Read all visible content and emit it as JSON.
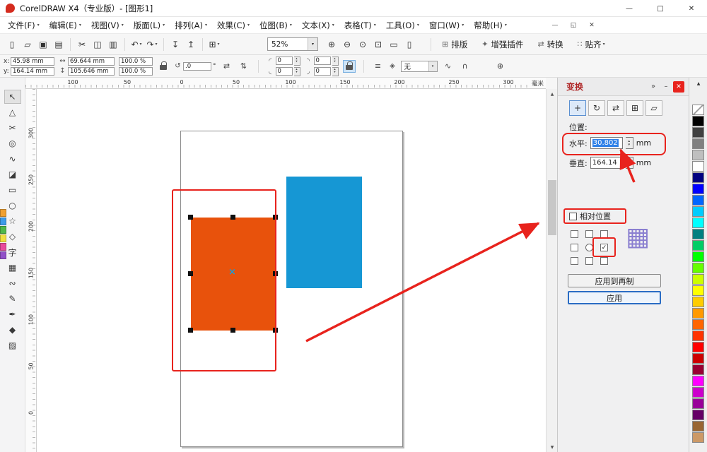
{
  "window": {
    "title": "CorelDRAW X4（专业版）- [图形1]",
    "controls": {
      "minimize": "—",
      "maximize": "□",
      "close": "✕"
    }
  },
  "menubar": {
    "items": [
      "文件(F)",
      "编辑(E)",
      "视图(V)",
      "版面(L)",
      "排列(A)",
      "效果(C)",
      "位图(B)",
      "文本(X)",
      "表格(T)",
      "工具(O)",
      "窗口(W)",
      "帮助(H)"
    ],
    "caret": "▾",
    "doc_controls": {
      "minimize": "—",
      "restore": "◱",
      "close": "✕"
    }
  },
  "glyphs": {
    "caret_down": "▾",
    "scroll_up": "▲",
    "scroll_down": "▼"
  },
  "toolbar": {
    "main_icons": [
      {
        "name": "new-document-icon",
        "glyph": "▯"
      },
      {
        "name": "open-icon",
        "glyph": "▱"
      },
      {
        "name": "save-icon",
        "glyph": "▣"
      },
      {
        "name": "print-icon",
        "glyph": "▤"
      },
      {
        "sep": true
      },
      {
        "name": "cut-icon",
        "glyph": "✂"
      },
      {
        "name": "copy-icon",
        "glyph": "◫"
      },
      {
        "name": "paste-icon",
        "glyph": "▥"
      },
      {
        "sep": true
      },
      {
        "name": "undo-icon",
        "glyph": "↶",
        "caret": true
      },
      {
        "name": "redo-icon",
        "glyph": "↷",
        "caret": true
      },
      {
        "sep": true
      },
      {
        "name": "import-icon",
        "glyph": "↧"
      },
      {
        "name": "export-icon",
        "glyph": "↥"
      },
      {
        "sep": true
      },
      {
        "name": "app-launcher-icon",
        "glyph": "⊞",
        "caret": true
      }
    ],
    "zoom_level": "52%",
    "zoom_icons": [
      {
        "name": "zoom-in-icon",
        "glyph": "⊕"
      },
      {
        "name": "zoom-out-icon",
        "glyph": "⊖"
      },
      {
        "name": "zoom-selected-icon",
        "glyph": "⊙"
      },
      {
        "name": "zoom-all-objects-icon",
        "glyph": "⊡"
      },
      {
        "name": "zoom-page-icon",
        "glyph": "▭"
      },
      {
        "name": "zoom-width-icon",
        "glyph": "▯"
      }
    ],
    "labeled_buttons": [
      {
        "name": "layout-button",
        "icon": "⊞",
        "label": "排版"
      },
      {
        "name": "plugins-button",
        "icon": "✦",
        "label": "增强插件"
      },
      {
        "name": "convert-button",
        "icon": "⇄",
        "label": "转换"
      },
      {
        "name": "snap-button",
        "icon": "∷",
        "label": "贴齐",
        "caret": true
      }
    ]
  },
  "property_bar": {
    "x_label": "x:",
    "x_value": "45.98 mm",
    "y_label": "y:",
    "y_value": "164.14 mm",
    "width_value": "69.644 mm",
    "height_value": "105.646 mm",
    "scale_h": "100.0 %",
    "scale_v": "100.0 %",
    "rotation_value": ".0",
    "degree": "°",
    "corner_tl": "0",
    "corner_bl": "0",
    "corner_tr": "0",
    "corner_br": "0",
    "outline_value": "无",
    "icons": {
      "width": "↔",
      "height": "↕",
      "rotation": "↺",
      "mirror_h": "⇄",
      "mirror_v": "⇅",
      "corner_tl": "◜",
      "corner_bl": "◟",
      "corner_tr": "◝",
      "corner_br": "◞",
      "wrap": "≡",
      "outline": "◈",
      "convert": "∿",
      "weld": "∩",
      "quick": "⊕"
    }
  },
  "rulers": {
    "h_numbers": [
      "100",
      "50",
      "0",
      "50",
      "100",
      "150",
      "200",
      "250",
      "300"
    ],
    "v_numbers": [
      "300",
      "250",
      "200",
      "150",
      "100",
      "50",
      "0"
    ],
    "unit_label": "毫米"
  },
  "toolbox": {
    "tools": [
      {
        "name": "pick-tool",
        "glyph": "↖"
      },
      {
        "name": "shape-tool",
        "glyph": "△"
      },
      {
        "name": "crop-tool",
        "glyph": "✂"
      },
      {
        "name": "zoom-tool",
        "glyph": "◎"
      },
      {
        "name": "freehand-tool",
        "glyph": "∿"
      },
      {
        "name": "smart-fill-tool",
        "glyph": "◪"
      },
      {
        "name": "rectangle-tool",
        "glyph": "▭"
      },
      {
        "name": "ellipse-tool",
        "glyph": "○"
      },
      {
        "name": "polygon-tool",
        "glyph": "☆"
      },
      {
        "name": "basic-shapes-tool",
        "glyph": "◇"
      },
      {
        "name": "text-tool",
        "glyph": "字"
      },
      {
        "name": "table-tool",
        "glyph": "▦"
      },
      {
        "name": "interactive-blend-tool",
        "glyph": "∾"
      },
      {
        "name": "eyedropper-tool",
        "glyph": "✎"
      },
      {
        "name": "outline-pen-tool",
        "glyph": "✒"
      },
      {
        "name": "fill-tool",
        "glyph": "◆"
      },
      {
        "name": "interactive-fill-tool",
        "glyph": "▨"
      }
    ]
  },
  "canvas": {
    "orange": "#e8520c",
    "blue": "#1697d4",
    "annotation_red": "#e8231d",
    "center_glyph": "×",
    "center_color": "#1b9cd8"
  },
  "docker": {
    "title": "变换",
    "chevron": "»",
    "controls": {
      "minimize": "–",
      "close": "✕"
    },
    "tools": [
      {
        "name": "transform-position-button",
        "glyph": "+"
      },
      {
        "name": "transform-rotate-button",
        "glyph": "↻"
      },
      {
        "name": "transform-scale-mirror-button",
        "glyph": "⇄"
      },
      {
        "name": "transform-size-button",
        "glyph": "⊞"
      },
      {
        "name": "transform-skew-button",
        "glyph": "▱"
      }
    ],
    "position_label": "位置:",
    "horizontal_label": "水平:",
    "horizontal_value": "30.802",
    "vertical_label": "垂直:",
    "vertical_value": "164.14",
    "unit": "mm",
    "relative_label": "相对位置",
    "anchor_grid": [
      "box",
      "box",
      "box",
      "box",
      "radio",
      "checked",
      "box",
      "box",
      "box"
    ],
    "grid_icon": "▦",
    "apply_to_duplicate_label": "应用到再制",
    "apply_label": "应用"
  },
  "palette": {
    "colors": [
      "none",
      "#000000",
      "#404040",
      "#808080",
      "#bfbfbf",
      "#ffffff",
      "#000080",
      "#0000ff",
      "#0066ff",
      "#00ccff",
      "#00ffff",
      "#008080",
      "#00cc66",
      "#00ff00",
      "#66ff00",
      "#ccff00",
      "#ffff00",
      "#ffcc00",
      "#ff9900",
      "#ff6600",
      "#ff3300",
      "#ff0000",
      "#cc0000",
      "#990033",
      "#ff00ff",
      "#cc00cc",
      "#990099",
      "#660066",
      "#996633",
      "#cc9966"
    ]
  },
  "left_strip": {
    "colors": [
      "#f0a030",
      "#3d9be8",
      "#50b84a",
      "#f0e040",
      "#e84a9b",
      "#9050c8"
    ]
  }
}
